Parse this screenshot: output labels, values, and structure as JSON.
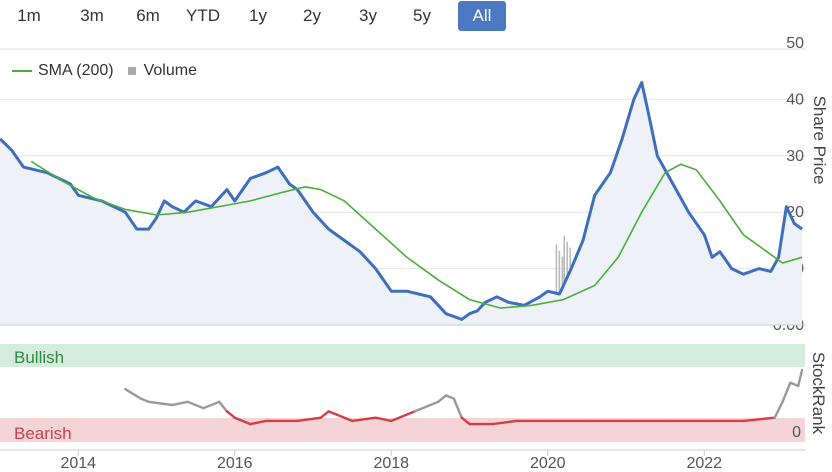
{
  "range_buttons": [
    {
      "label": "1m",
      "active": false
    },
    {
      "label": "3m",
      "active": false
    },
    {
      "label": "6m",
      "active": false
    },
    {
      "label": "YTD",
      "active": false
    },
    {
      "label": "1y",
      "active": false
    },
    {
      "label": "2y",
      "active": false
    },
    {
      "label": "3y",
      "active": false
    },
    {
      "label": "5y",
      "active": false
    },
    {
      "label": "All",
      "active": true
    }
  ],
  "legend": {
    "sma_label": "SMA (200)",
    "volume_label": "Volume"
  },
  "colors": {
    "price": "#3f6fba",
    "sma": "#4aad3c",
    "volume": "#bbbbbb",
    "bullish_band": "#d4ecdb",
    "bearish_band": "#f4d4d6",
    "bullish_text": "#2f8a44",
    "bearish_text": "#c8424c",
    "rank_red": "#d63e46",
    "rank_gray": "#999999",
    "active_button": "#4a78c2"
  },
  "chart_data": [
    {
      "type": "line",
      "ylabel": "Share Price",
      "ylim": [
        0,
        50
      ],
      "yticks": [
        "50",
        "40",
        "30",
        "20",
        "10",
        "0.00"
      ],
      "volume_ticks": [
        "120m",
        "80m",
        "40m",
        "0"
      ],
      "grid": true,
      "legend_position": "top-left",
      "series": [
        {
          "name": "Price",
          "x": [
            2013.0,
            2013.15,
            2013.3,
            2013.6,
            2013.9,
            2014.0,
            2014.3,
            2014.6,
            2014.75,
            2014.9,
            2015.0,
            2015.1,
            2015.2,
            2015.35,
            2015.5,
            2015.7,
            2015.9,
            2016.0,
            2016.2,
            2016.4,
            2016.55,
            2016.7,
            2016.8,
            2016.9,
            2017.0,
            2017.2,
            2017.4,
            2017.6,
            2017.8,
            2018.0,
            2018.2,
            2018.35,
            2018.5,
            2018.7,
            2018.9,
            2019.0,
            2019.1,
            2019.2,
            2019.35,
            2019.5,
            2019.7,
            2019.9,
            2020.0,
            2020.15,
            2020.3,
            2020.45,
            2020.6,
            2020.7,
            2020.8,
            2020.95,
            2021.1,
            2021.2,
            2021.28,
            2021.4,
            2021.6,
            2021.8,
            2022.0,
            2022.1,
            2022.2,
            2022.35,
            2022.5,
            2022.7,
            2022.85,
            2022.95,
            2023.05,
            2023.15,
            2023.25
          ],
          "y": [
            33,
            31,
            28,
            27,
            25,
            23,
            22,
            20,
            17,
            17,
            19,
            22,
            21,
            20,
            22,
            21,
            24,
            22,
            26,
            27,
            28,
            25,
            24,
            22,
            20,
            17,
            15,
            13,
            10,
            6,
            6,
            5.5,
            5,
            2,
            1,
            2,
            2.5,
            4,
            5,
            4,
            3.5,
            5,
            6,
            5.5,
            10,
            15,
            23,
            25,
            27,
            33,
            40,
            43,
            38,
            30,
            25,
            20,
            16,
            12,
            13,
            10,
            9,
            10,
            9.5,
            12,
            21,
            18,
            17
          ]
        },
        {
          "name": "SMA (200)",
          "x": [
            2013.4,
            2013.8,
            2014.2,
            2014.6,
            2015.0,
            2015.4,
            2015.8,
            2016.2,
            2016.6,
            2016.9,
            2017.1,
            2017.4,
            2017.8,
            2018.2,
            2018.6,
            2019.0,
            2019.4,
            2019.8,
            2020.2,
            2020.6,
            2020.9,
            2021.2,
            2021.5,
            2021.7,
            2021.9,
            2022.2,
            2022.5,
            2022.8,
            2023.0,
            2023.25
          ],
          "y": [
            29,
            25.5,
            22.5,
            20.5,
            19.5,
            20,
            21,
            22,
            23.5,
            24.5,
            24,
            22,
            17,
            12,
            8,
            4.5,
            3,
            3.5,
            4.5,
            7,
            12,
            20,
            27,
            28.5,
            27.5,
            22,
            16,
            13,
            11,
            12
          ]
        },
        {
          "name": "Volume",
          "y_units": "shares",
          "x": [
            2019.0,
            2019.5,
            2019.9,
            2020.1,
            2020.2,
            2020.3,
            2020.4,
            2020.5,
            2020.6,
            2020.8,
            2021.0,
            2021.1,
            2021.2,
            2021.3,
            2021.5,
            2021.7,
            2021.9,
            2022.2,
            2022.5,
            2022.8,
            2023.1
          ],
          "y": [
            5,
            12,
            30,
            90,
            100,
            60,
            80,
            40,
            30,
            20,
            50,
            65,
            55,
            45,
            30,
            28,
            25,
            20,
            18,
            15,
            35
          ]
        }
      ]
    },
    {
      "type": "line",
      "ylabel": "StockRank",
      "yticks": [
        "0"
      ],
      "bands": [
        {
          "label": "Bullish"
        },
        {
          "label": "Bearish"
        }
      ],
      "series": [
        {
          "name": "StockRank",
          "x": [
            2014.6,
            2014.8,
            2014.9,
            2015.2,
            2015.4,
            2015.6,
            2015.8,
            2015.9,
            2016.0,
            2016.2,
            2016.4,
            2016.8,
            2017.1,
            2017.2,
            2017.5,
            2017.8,
            2018.0,
            2018.3,
            2018.6,
            2018.7,
            2018.8,
            2018.9,
            2019.0,
            2019.3,
            2019.6,
            2020.0,
            2020.5,
            2021.0,
            2021.5,
            2022.0,
            2022.5,
            2022.9,
            2023.0,
            2023.1,
            2023.2,
            2023.25
          ],
          "y": [
            80,
            65,
            60,
            55,
            60,
            50,
            60,
            45,
            35,
            25,
            30,
            30,
            35,
            45,
            30,
            35,
            30,
            45,
            60,
            70,
            65,
            35,
            25,
            25,
            30,
            30,
            30,
            30,
            30,
            30,
            30,
            35,
            60,
            90,
            85,
            110
          ]
        }
      ]
    }
  ],
  "x_axis": {
    "ticks": [
      "2014",
      "2016",
      "2018",
      "2020",
      "2022"
    ]
  }
}
